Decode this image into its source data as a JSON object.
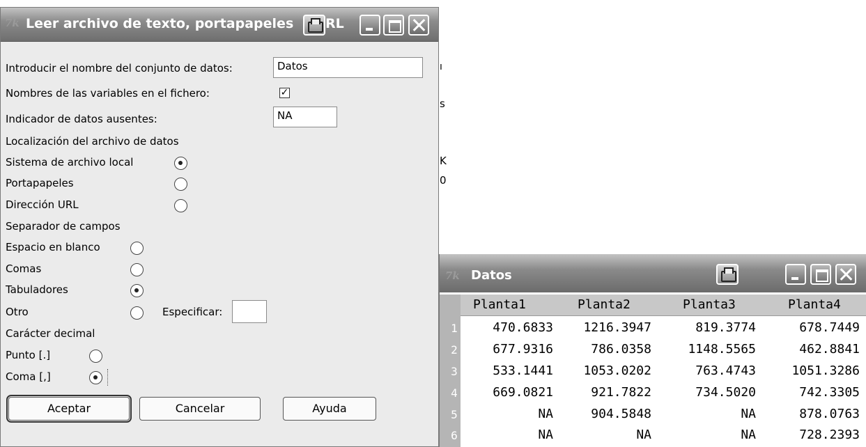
{
  "dialog": {
    "title": "Leer archivo de texto, portapapeles",
    "title_overflow": "RL",
    "fields": {
      "dataset_label": "Introducir el nombre del conjunto de datos:",
      "dataset_value": "Datos",
      "varnames_label": "Nombres de las variables en el fichero:",
      "varnames_checked": "✓",
      "missing_label": "Indicador de datos ausentes:",
      "missing_value": "NA"
    },
    "location": {
      "section": "Localización del archivo de datos",
      "options": [
        "Sistema de archivo local",
        "Portapapeles",
        "Dirección URL"
      ],
      "selected": "Sistema de archivo local"
    },
    "separator": {
      "section": "Separador de campos",
      "options": [
        "Espacio en blanco",
        "Comas",
        "Tabuladores",
        "Otro"
      ],
      "selected": "Tabuladores",
      "specify_label": "Especificar:",
      "specify_value": ""
    },
    "decimal": {
      "section": "Carácter decimal",
      "options": [
        "Punto [.]",
        "Coma [,]"
      ],
      "selected": "Coma [,]"
    },
    "buttons": {
      "ok": "Aceptar",
      "cancel": "Cancelar",
      "help": "Ayuda"
    }
  },
  "viewer": {
    "title": "Datos",
    "columns": [
      "Planta1",
      "Planta2",
      "Planta3",
      "Planta4"
    ],
    "rows": [
      {
        "n": "1",
        "v": [
          "470.6833",
          "1216.3947",
          "819.3774",
          "678.7449"
        ]
      },
      {
        "n": "2",
        "v": [
          "677.9316",
          "786.0358",
          "1148.5565",
          "462.8841"
        ]
      },
      {
        "n": "3",
        "v": [
          "533.1441",
          "1053.0202",
          "763.4743",
          "1051.3286"
        ]
      },
      {
        "n": "4",
        "v": [
          "669.0821",
          "921.7822",
          "734.5020",
          "742.3305"
        ]
      },
      {
        "n": "5",
        "v": [
          "NA",
          "904.5848",
          "NA",
          "878.0763"
        ]
      },
      {
        "n": "6",
        "v": [
          "NA",
          "NA",
          "NA",
          "728.2393"
        ]
      }
    ]
  },
  "background": {
    "fragments": [
      "K",
      "0",
      "s"
    ]
  },
  "logo": "7k"
}
